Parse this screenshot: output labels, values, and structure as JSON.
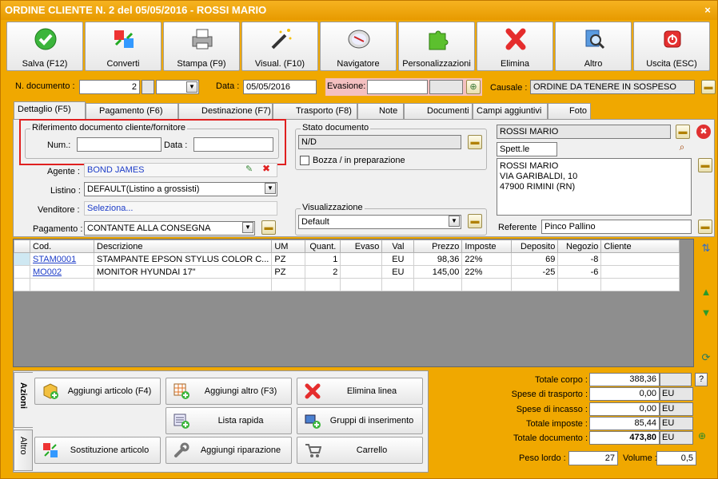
{
  "window": {
    "title": "ORDINE CLIENTE N. 2 del 05/05/2016 - ROSSI MARIO",
    "close": "×"
  },
  "toolbar": [
    {
      "label": "Salva (F12)"
    },
    {
      "label": "Converti"
    },
    {
      "label": "Stampa (F9)"
    },
    {
      "label": "Visual. (F10)"
    },
    {
      "label": "Navigatore"
    },
    {
      "label": "Personalizzazioni"
    },
    {
      "label": "Elimina"
    },
    {
      "label": "Altro"
    },
    {
      "label": "Uscita (ESC)"
    }
  ],
  "header": {
    "num_label": "N. documento :",
    "num_value": "2",
    "data_label": "Data :",
    "data_value": "05/05/2016",
    "evasione_label": "Evasione:",
    "causale_label": "Causale :",
    "causale_value": "ORDINE DA TENERE IN SOSPESO"
  },
  "tabs": [
    {
      "label": "Dettaglio (F5)"
    },
    {
      "label": "Pagamento (F6)"
    },
    {
      "label": "Destinazione (F7)"
    },
    {
      "label": "Trasporto (F8)"
    },
    {
      "label": "Note"
    },
    {
      "label": "Documenti"
    },
    {
      "label": "Campi aggiuntivi"
    },
    {
      "label": "Foto"
    }
  ],
  "riferimento": {
    "title": "Riferimento documento cliente/fornitore",
    "num_label": "Num.:",
    "data_label": "Data :"
  },
  "fields": {
    "agente_label": "Agente :",
    "agente_value": "BOND JAMES",
    "listino_label": "Listino :",
    "listino_value": "DEFAULT(Listino a grossisti)",
    "venditore_label": "Venditore :",
    "venditore_value": "Seleziona...",
    "pagamento_label": "Pagamento :",
    "pagamento_value": "CONTANTE ALLA CONSEGNA"
  },
  "stato": {
    "title": "Stato documento",
    "value": "N/D",
    "bozza_label": "Bozza / in preparazione"
  },
  "visualizzazione": {
    "title": "Visualizzazione",
    "value": "Default"
  },
  "cliente": {
    "name": "ROSSI MARIO",
    "title": "Spett.le",
    "address": [
      "ROSSI MARIO",
      "VIA GARIBALDI, 10",
      "47900 RIMINI (RN)"
    ],
    "referente_label": "Referente",
    "referente_value": "Pinco Pallino"
  },
  "grid": {
    "columns": [
      "Cod.",
      "Descrizione",
      "UM",
      "Quant.",
      "Evaso",
      "Val",
      "Prezzo",
      "Imposte",
      "Deposito",
      "Negozio",
      "Cliente"
    ],
    "rows": [
      {
        "cod": "STAM0001",
        "desc": "STAMPANTE EPSON STYLUS COLOR C...",
        "um": "PZ",
        "quant": "1",
        "evaso": "",
        "val": "EU",
        "prezzo": "98,36",
        "imposte": "22%",
        "deposito": "69",
        "negozio": "-8",
        "cliente": ""
      },
      {
        "cod": "MO002",
        "desc": "MONITOR HYUNDAI 17\"",
        "um": "PZ",
        "quant": "2",
        "evaso": "",
        "val": "EU",
        "prezzo": "145,00",
        "imposte": "22%",
        "deposito": "-25",
        "negozio": "-6",
        "cliente": ""
      }
    ]
  },
  "actions": {
    "tab_azioni": "Azioni",
    "tab_altro": "Altro",
    "buttons": {
      "aggiungi_articolo": "Aggiungi articolo (F4)",
      "aggiungi_altro": "Aggiungi altro (F3)",
      "elimina_linea": "Elimina linea",
      "lista_rapida": "Lista rapida",
      "gruppi": "Gruppi di inserimento",
      "sostituzione": "Sostituzione articolo",
      "riparazione": "Aggiungi riparazione",
      "carrello": "Carrello"
    }
  },
  "totals": {
    "corpo_label": "Totale corpo :",
    "corpo_value": "388,36",
    "trasporto_label": "Spese di trasporto :",
    "trasporto_value": "0,00",
    "incasso_label": "Spese di incasso :",
    "incasso_value": "0,00",
    "imposte_label": "Totale imposte :",
    "imposte_value": "85,44",
    "documento_label": "Totale documento :",
    "documento_value": "473,80",
    "currency": "EU",
    "help": "?",
    "peso_label": "Peso lordo :",
    "peso_value": "27",
    "volume_label": "Volume :",
    "volume_value": "0,5"
  },
  "colors": {
    "accent": "#f0a800",
    "highlight_border": "#e02020",
    "link": "#1c3cc8"
  }
}
